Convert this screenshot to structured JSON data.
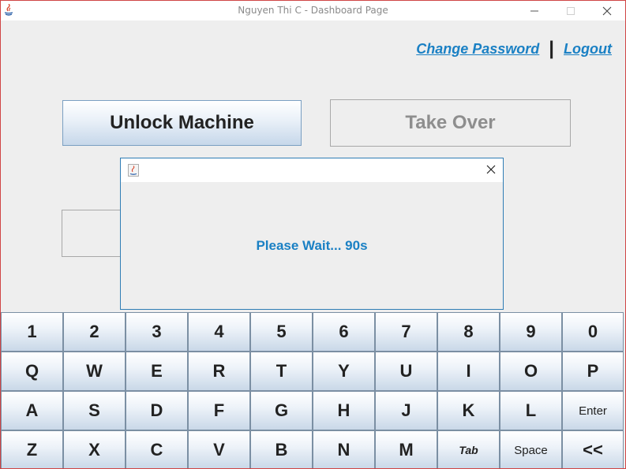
{
  "window": {
    "title": "Nguyen Thi C - Dashboard Page"
  },
  "header_links": {
    "change_password": "Change Password",
    "separator": "|",
    "logout": "Logout"
  },
  "actions": {
    "unlock_label": "Unlock Machine",
    "takeover_label": "Take Over"
  },
  "dialog": {
    "message": "Please Wait... 90s"
  },
  "keyboard": {
    "rows": [
      [
        "1",
        "2",
        "3",
        "4",
        "5",
        "6",
        "7",
        "8",
        "9",
        "0"
      ],
      [
        "Q",
        "W",
        "E",
        "R",
        "T",
        "Y",
        "U",
        "I",
        "O",
        "P"
      ],
      [
        "A",
        "S",
        "D",
        "F",
        "G",
        "H",
        "J",
        "K",
        "L",
        "Enter"
      ],
      [
        "Z",
        "X",
        "C",
        "V",
        "B",
        "N",
        "M",
        "Tab",
        "Space",
        "<<"
      ]
    ]
  },
  "colors": {
    "accent": "#1a80c4",
    "window_border": "#d04545",
    "dialog_border": "#2f7db5"
  }
}
